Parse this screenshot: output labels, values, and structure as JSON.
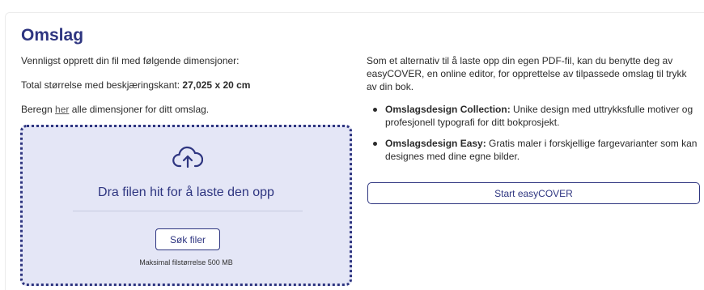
{
  "section": {
    "title": "Omslag",
    "instruction": "Vennligst opprett din fil med følgende dimensjoner:",
    "total_label": "Total størrelse med beskjæringskant: ",
    "total_value": "27,025 x 20 cm",
    "calc_prefix": "Beregn ",
    "calc_link": "her",
    "calc_suffix": " alle dimensjoner for ditt omslag."
  },
  "dropzone": {
    "icon": "cloud-upload-icon",
    "title": "Dra filen hit for å laste den opp",
    "button_label": "Søk filer",
    "max_size_note": "Maksimal filstørrelse 500 MB"
  },
  "easycover": {
    "intro": "Som et alternativ til å laste opp din egen PDF-fil, kan du benytte deg av easyCOVER, en online editor, for opprettelse av tilpassede omslag til trykk av din bok.",
    "items": [
      {
        "title": "Omslagsdesign Collection:",
        "text": " Unike design med uttrykksfulle motiver og profesjonell typografi for ditt bokprosjekt."
      },
      {
        "title": "Omslagsdesign Easy:",
        "text": " Gratis maler i forskjellige fargevarianter som kan designes med dine egne bilder."
      }
    ],
    "button_label": "Start easyCOVER"
  },
  "colors": {
    "accent": "#2e3580",
    "dropzone_bg": "#e4e6f6"
  }
}
